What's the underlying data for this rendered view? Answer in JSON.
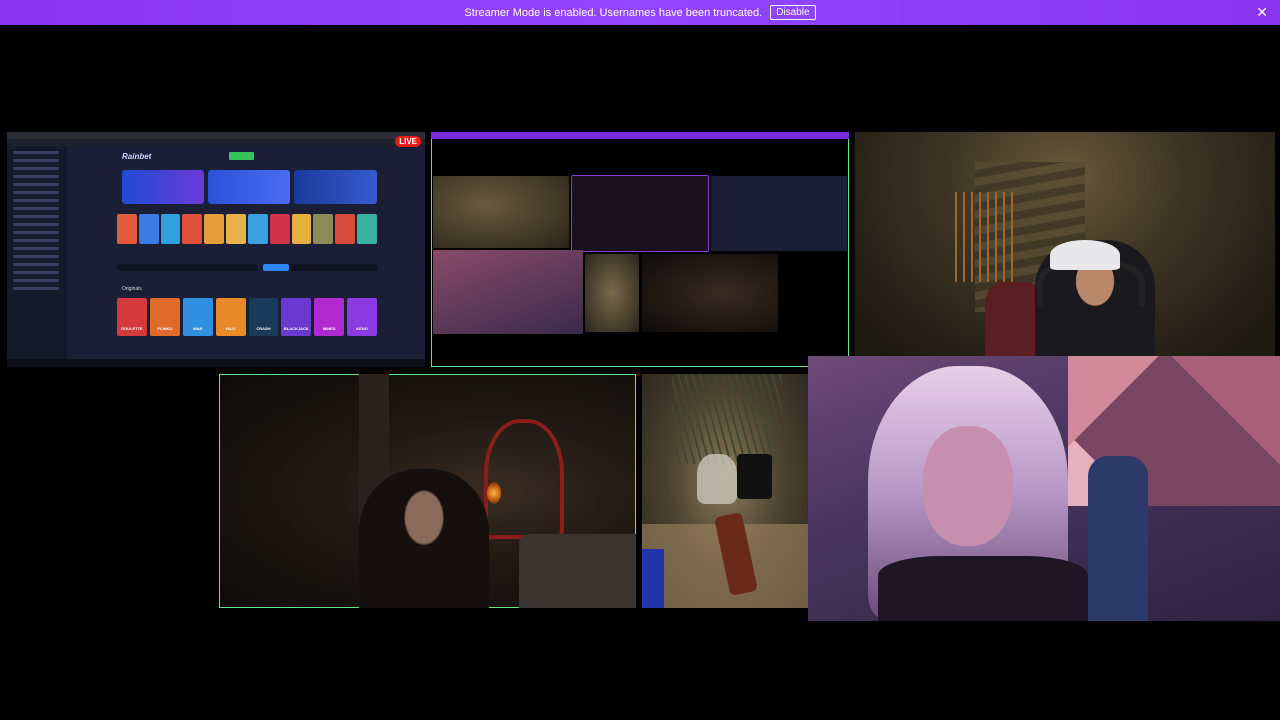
{
  "banner": {
    "message": "Streamer Mode is enabled. Usernames have been truncated.",
    "disable_label": "Disable",
    "close_glyph": "✕"
  },
  "tiles": {
    "casino": {
      "live_label": "LIVE",
      "logo_text": "Rainbet",
      "originals_label": "Originals",
      "originals": [
        "ROULETTE",
        "PLINKO",
        "WAR",
        "HILO",
        "CRASH",
        "BLACKJACK",
        "MINES",
        "KENO"
      ]
    }
  }
}
